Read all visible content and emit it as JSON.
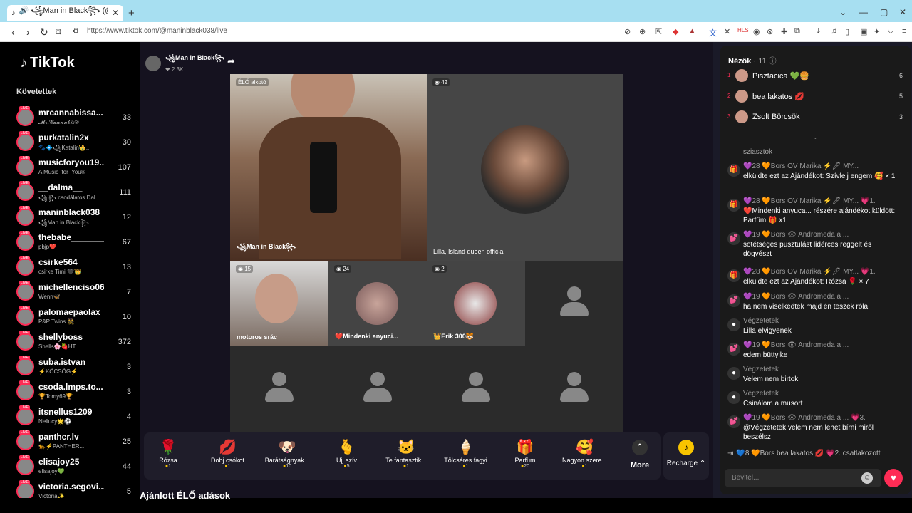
{
  "browser": {
    "tab_title": "🔊 ꧁Man in Black꧂ (@maninbl…",
    "url": "https://www.tiktok.com/@maninblack038/live"
  },
  "sidebar": {
    "logo": "TikTok",
    "section": "Követettek",
    "following": [
      {
        "name": "mrcannabissa...",
        "sub": "𝓜𝓻.𝓒𝓪𝓷𝓷𝓪𝓫𝓲𝓼®",
        "count": "33"
      },
      {
        "name": "purkatalin2x",
        "sub": "🐾💠꧁Katalin👑...",
        "count": "30"
      },
      {
        "name": "musicforyou19...",
        "sub": "A Music_for_You®",
        "count": "107"
      },
      {
        "name": "__dalma__",
        "sub": "꧁꧂ csodálatos Dal...",
        "count": "111"
      },
      {
        "name": "maninblack038",
        "sub": "꧁Man in Black꧂",
        "count": "12"
      },
      {
        "name": "thebabe_______",
        "sub": "pbjp❤️",
        "count": "67"
      },
      {
        "name": "csirke564",
        "sub": "csirke Timi 🖤👑",
        "count": "13"
      },
      {
        "name": "michellenciso06",
        "sub": "Wenn🦋",
        "count": "7"
      },
      {
        "name": "palomaepaolax",
        "sub": "P&P Twins 👯",
        "count": "10"
      },
      {
        "name": "shellyboss",
        "sub": "Shells🌸🍓HT",
        "count": "372"
      },
      {
        "name": "suba.istvan",
        "sub": "⚡KÖCSÖG⚡",
        "count": "3"
      },
      {
        "name": "csoda.lmps.to...",
        "sub": "🏆Tomy69🏆...",
        "count": "3"
      },
      {
        "name": "itsnellus1209",
        "sub": "Nellucy🌟⚽...",
        "count": "4"
      },
      {
        "name": "panther.lv",
        "sub": "🐆⚡PANTHER...",
        "count": "25"
      },
      {
        "name": "elisajoy25",
        "sub": "elisajoy💚",
        "count": "44"
      },
      {
        "name": "victoria.segovi...",
        "sub": "Victoria✨",
        "count": "5"
      }
    ]
  },
  "host": {
    "name": "꧁Man in Black꧂",
    "stat": "❤ 2.3K"
  },
  "grid": {
    "main_tag": "ÉLŐ alkotó",
    "main_name": "꧁Man in Black꧂",
    "guest1_count": "42",
    "guest1_name": "Lilla, Island queen official",
    "g2_count": "15",
    "g2_name": "motoros srác",
    "g3_count": "24",
    "g3_name": "❤️Mindenki anyuci...",
    "g4_count": "2",
    "g4_name": "👑Erik 300🐯"
  },
  "gifts": [
    {
      "icon": "🌹",
      "name": "Rózsa",
      "price": "1"
    },
    {
      "icon": "💋",
      "name": "Dobj csókot",
      "price": "1"
    },
    {
      "icon": "🐶",
      "name": "Barátságnyak...",
      "price": "10"
    },
    {
      "icon": "🫰",
      "name": "Ujj szív",
      "price": "5"
    },
    {
      "icon": "🐱",
      "name": "Te fantasztik...",
      "price": "1"
    },
    {
      "icon": "🍦",
      "name": "Tölcséres fagyi",
      "price": "1"
    },
    {
      "icon": "🎁",
      "name": "Parfüm",
      "price": "20"
    },
    {
      "icon": "🥰",
      "name": "Nagyon szere...",
      "price": "1"
    }
  ],
  "more_label": "More",
  "recharge_label": "Recharge ⌃",
  "suggest": "Ajánlott ÉLŐ adások",
  "panel": {
    "title": "Nézők",
    "count": "· 11",
    "viewers": [
      {
        "rank": "1",
        "name": "Pisztacica 💚🍔",
        "score": "6"
      },
      {
        "rank": "2",
        "name": "bea lakatos 💋",
        "score": "5"
      },
      {
        "rank": "3",
        "name": "Zsolt Börcsök",
        "score": "3"
      }
    ],
    "messages": [
      {
        "icon": "🎁",
        "head": "💜28 🧡Bors OV Marika ⚡🖊 MY...",
        "body": "elküldte ezt az Ajándékot: Szívlelj engem 🥰 × 1"
      },
      {
        "icon": "🎁",
        "head": "💜28 🧡Bors OV Marika ⚡🖊 MY... 💗1.",
        "body": "❤️Mindenki anyuca... részére ajándékot küldött: Parfüm 🎁 x1"
      },
      {
        "icon": "💕",
        "head": "💜19 🧡Bors 👁 Andromeda a ...",
        "body": "sötétséges pusztulást lidérces reggelt és dögvészt"
      },
      {
        "icon": "🎁",
        "head": "💜28 🧡Bors OV Marika ⚡🖊 MY... 💗1.",
        "body": "elküldte ezt az Ajándékot: Rózsa 🌹 × 7"
      },
      {
        "icon": "💕",
        "head": "💜19 🧡Bors 👁 Andromeda a ...",
        "body": "ha nem viselkedtek majd én teszek róla"
      },
      {
        "icon": "●",
        "head": "Végzetetek",
        "body": "Lilla elvigyenek"
      },
      {
        "icon": "💕",
        "head": "💜19 🧡Bors 👁 Andromeda a ...",
        "body": "edem büttyike"
      },
      {
        "icon": "●",
        "head": "Végzetetek",
        "body": "Velem nem birtok"
      },
      {
        "icon": "●",
        "head": "Végzetetek",
        "body": "Csinálom a musort"
      },
      {
        "icon": "💕",
        "head": "💜19 🧡Bors 👁 Andromeda a ... 💗3.",
        "body": "@Végzetetek velem nem lehet bírni miről beszélsz"
      }
    ],
    "join": "💙8 🧡Bors bea lakatos 💋 💗2. csatlakozott",
    "input_placeholder": "Bevitel...",
    "scroll_prev": "sziasztok"
  }
}
